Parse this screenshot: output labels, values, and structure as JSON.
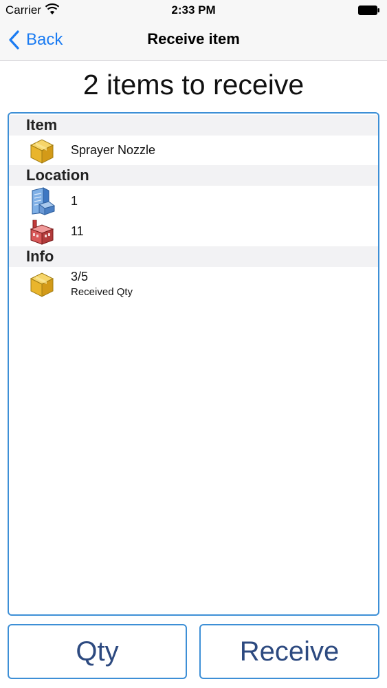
{
  "status_bar": {
    "carrier": "Carrier",
    "time": "2:33 PM"
  },
  "nav": {
    "back_label": "Back",
    "title": "Receive item"
  },
  "heading": "2 items to receive",
  "sections": {
    "item": {
      "header": "Item",
      "rows": [
        {
          "icon": "box-icon",
          "text": "Sprayer Nozzle"
        }
      ]
    },
    "location": {
      "header": "Location",
      "rows": [
        {
          "icon": "building-icon",
          "text": "1"
        },
        {
          "icon": "warehouse-icon",
          "text": "11"
        }
      ]
    },
    "info": {
      "header": "Info",
      "rows": [
        {
          "icon": "box-icon",
          "text": "3/5",
          "subtext": "Received Qty"
        }
      ]
    }
  },
  "buttons": {
    "qty": "Qty",
    "receive": "Receive"
  },
  "colors": {
    "accent": "#1a7bf2",
    "border": "#3d8fd6",
    "button_text": "#2d4a80"
  }
}
